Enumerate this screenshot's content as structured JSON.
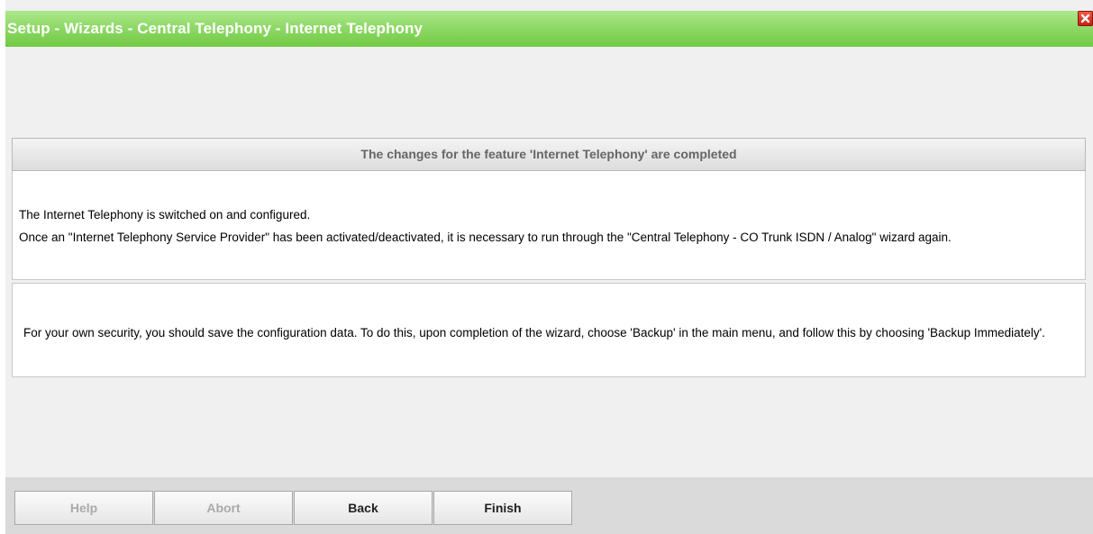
{
  "window": {
    "title": "Setup - Wizards - Central Telephony - Internet Telephony",
    "close_icon": "close-icon",
    "colors": {
      "title_bar": "#8fd968",
      "close_button": "#d9291c",
      "background": "#f0f0f0",
      "footer": "#dadada"
    }
  },
  "header": {
    "text": "The changes for the feature 'Internet Telephony' are completed"
  },
  "info": {
    "line1": "The Internet Telephony is switched on and configured.",
    "line2": "Once an \"Internet Telephony Service Provider\" has been activated/deactivated, it is necessary to run through the \"Central Telephony - CO Trunk ISDN / Analog\" wizard again."
  },
  "security": {
    "text": "For your own security, you should save the configuration data. To do this, upon completion of the wizard, choose 'Backup' in the main menu, and follow this by choosing 'Backup Immediately'."
  },
  "buttons": {
    "help": "Help",
    "abort": "Abort",
    "back": "Back",
    "finish": "Finish"
  }
}
